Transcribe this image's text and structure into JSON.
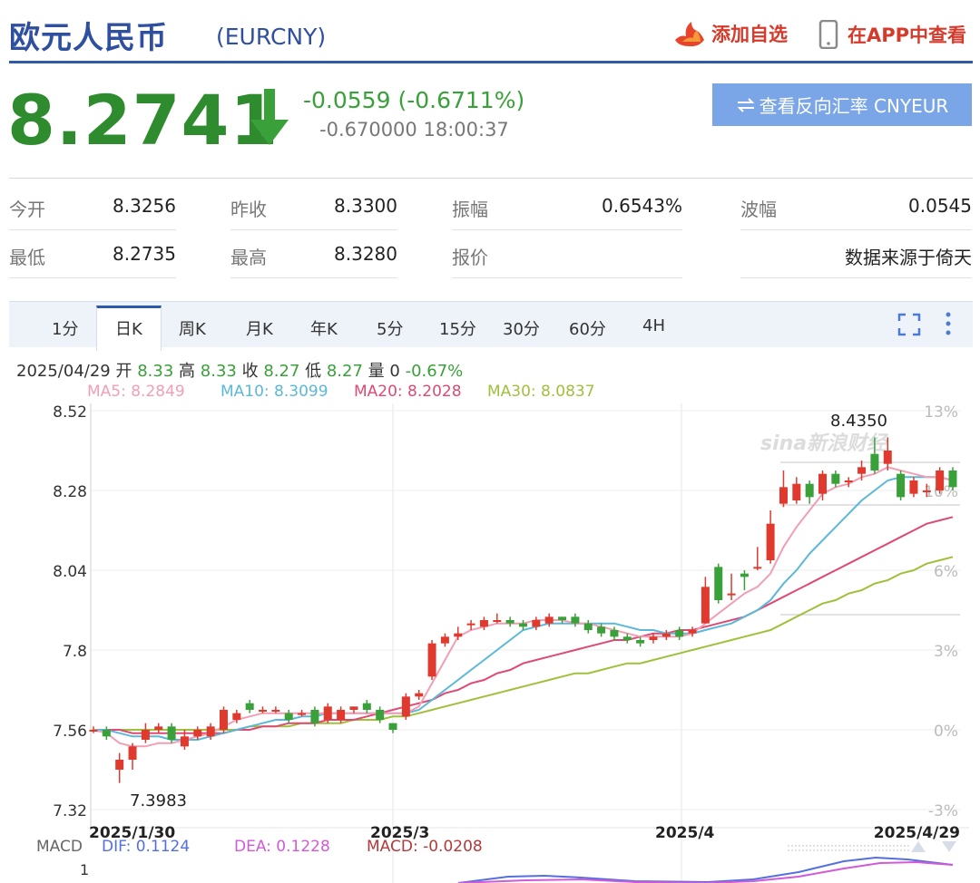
{
  "header": {
    "title": "欧元人民币",
    "code": "(EURCNY)",
    "add_watchlist": "添加自选",
    "view_app": "在APP中查看"
  },
  "quote": {
    "price": "8.2741",
    "change": "-0.0559 (-0.6711%)",
    "change2": "-0.670000",
    "time": "18:00:37",
    "reverse_btn": "查看反向汇率 CNYEUR"
  },
  "stats": {
    "open_label": "今开",
    "open": "8.3256",
    "prev_label": "昨收",
    "prev": "8.3300",
    "amp_label": "振幅",
    "amp": "0.6543%",
    "wave_label": "波幅",
    "wave": "0.0545",
    "low_label": "最低",
    "low": "8.2735",
    "high_label": "最高",
    "high": "8.3280",
    "quote_label": "报价",
    "source": "数据来源于倚天"
  },
  "tabs": [
    "1分",
    "日K",
    "周K",
    "月K",
    "年K",
    "5分",
    "15分",
    "30分",
    "60分",
    "4H"
  ],
  "active_tab": "日K",
  "ohlc": {
    "date": "2025/04/29",
    "open_label": "开",
    "open": "8.33",
    "high_label": "高",
    "high": "8.33",
    "close_label": "收",
    "close": "8.27",
    "low_label": "低",
    "low": "8.27",
    "vol_label": "量",
    "vol": "0",
    "pct": "-0.67%"
  },
  "ma": {
    "ma5": "MA5: 8.2849",
    "ma10": "MA10: 8.3099",
    "ma20": "MA20: 8.2028",
    "ma30": "MA30: 8.0837"
  },
  "macd": {
    "label": "MACD",
    "dif": "DIF: 0.1124",
    "dea": "DEA: 0.1228",
    "macd": "MACD: -0.0208",
    "axis_1": "1"
  },
  "colors": {
    "up": "#e03a2f",
    "down": "#3aa03a",
    "ma5": "#f29fb4",
    "ma10": "#5bb8d8",
    "ma20": "#de4a74",
    "ma30": "#a0c03c",
    "dif": "#5470e0",
    "dea": "#d25ad8",
    "macd": "#b33a3a"
  },
  "chart_data": {
    "type": "candlestick",
    "y_ticks": [
      "8.52",
      "8.28",
      "8.04",
      "7.8",
      "7.56",
      "7.32"
    ],
    "y_ticks_right": [
      "13%",
      "10%",
      "6%",
      "3%",
      "0%",
      "-3%"
    ],
    "x_ticks": [
      "2025/1/30",
      "2025/3",
      "2025/4",
      "2025/4/29"
    ],
    "ylim": [
      7.32,
      8.52
    ],
    "min_label": "7.3983",
    "max_label": "8.4350",
    "watermark": "sina新浪财经",
    "candles": [
      {
        "o": 7.56,
        "c": 7.56,
        "h": 7.57,
        "l": 7.55
      },
      {
        "o": 7.56,
        "c": 7.54,
        "h": 7.57,
        "l": 7.53
      },
      {
        "o": 7.44,
        "c": 7.47,
        "h": 7.49,
        "l": 7.4
      },
      {
        "o": 7.47,
        "c": 7.51,
        "h": 7.52,
        "l": 7.44
      },
      {
        "o": 7.53,
        "c": 7.56,
        "h": 7.58,
        "l": 7.52
      },
      {
        "o": 7.56,
        "c": 7.57,
        "h": 7.58,
        "l": 7.55
      },
      {
        "o": 7.57,
        "c": 7.53,
        "h": 7.58,
        "l": 7.52
      },
      {
        "o": 7.51,
        "c": 7.54,
        "h": 7.56,
        "l": 7.5
      },
      {
        "o": 7.54,
        "c": 7.56,
        "h": 7.57,
        "l": 7.53
      },
      {
        "o": 7.54,
        "c": 7.57,
        "h": 7.58,
        "l": 7.53
      },
      {
        "o": 7.56,
        "c": 7.62,
        "h": 7.63,
        "l": 7.55
      },
      {
        "o": 7.59,
        "c": 7.61,
        "h": 7.62,
        "l": 7.58
      },
      {
        "o": 7.64,
        "c": 7.62,
        "h": 7.65,
        "l": 7.61
      },
      {
        "o": 7.62,
        "c": 7.62,
        "h": 7.63,
        "l": 7.61
      },
      {
        "o": 7.62,
        "c": 7.62,
        "h": 7.63,
        "l": 7.61
      },
      {
        "o": 7.61,
        "c": 7.59,
        "h": 7.62,
        "l": 7.58
      },
      {
        "o": 7.61,
        "c": 7.61,
        "h": 7.62,
        "l": 7.6
      },
      {
        "o": 7.62,
        "c": 7.58,
        "h": 7.63,
        "l": 7.57
      },
      {
        "o": 7.59,
        "c": 7.63,
        "h": 7.64,
        "l": 7.58
      },
      {
        "o": 7.59,
        "c": 7.62,
        "h": 7.63,
        "l": 7.58
      },
      {
        "o": 7.62,
        "c": 7.63,
        "h": 7.63,
        "l": 7.61
      },
      {
        "o": 7.64,
        "c": 7.62,
        "h": 7.65,
        "l": 7.61
      },
      {
        "o": 7.62,
        "c": 7.59,
        "h": 7.63,
        "l": 7.58
      },
      {
        "o": 7.58,
        "c": 7.56,
        "h": 7.58,
        "l": 7.55
      },
      {
        "o": 7.6,
        "c": 7.66,
        "h": 7.67,
        "l": 7.59
      },
      {
        "o": 7.66,
        "c": 7.67,
        "h": 7.68,
        "l": 7.65
      },
      {
        "o": 7.72,
        "c": 7.82,
        "h": 7.83,
        "l": 7.71
      },
      {
        "o": 7.82,
        "c": 7.84,
        "h": 7.85,
        "l": 7.81
      },
      {
        "o": 7.84,
        "c": 7.85,
        "h": 7.87,
        "l": 7.83
      },
      {
        "o": 7.88,
        "c": 7.88,
        "h": 7.89,
        "l": 7.86
      },
      {
        "o": 7.87,
        "c": 7.89,
        "h": 7.9,
        "l": 7.86
      },
      {
        "o": 7.89,
        "c": 7.89,
        "h": 7.91,
        "l": 7.88
      },
      {
        "o": 7.89,
        "c": 7.88,
        "h": 7.9,
        "l": 7.87
      },
      {
        "o": 7.88,
        "c": 7.87,
        "h": 7.89,
        "l": 7.86
      },
      {
        "o": 7.87,
        "c": 7.89,
        "h": 7.9,
        "l": 7.86
      },
      {
        "o": 7.88,
        "c": 7.9,
        "h": 7.91,
        "l": 7.87
      },
      {
        "o": 7.9,
        "c": 7.89,
        "h": 7.9,
        "l": 7.88
      },
      {
        "o": 7.9,
        "c": 7.88,
        "h": 7.91,
        "l": 7.87
      },
      {
        "o": 7.88,
        "c": 7.86,
        "h": 7.89,
        "l": 7.85
      },
      {
        "o": 7.87,
        "c": 7.85,
        "h": 7.88,
        "l": 7.84
      },
      {
        "o": 7.86,
        "c": 7.84,
        "h": 7.87,
        "l": 7.83
      },
      {
        "o": 7.84,
        "c": 7.83,
        "h": 7.85,
        "l": 7.82
      },
      {
        "o": 7.83,
        "c": 7.82,
        "h": 7.84,
        "l": 7.81
      },
      {
        "o": 7.83,
        "c": 7.84,
        "h": 7.85,
        "l": 7.82
      },
      {
        "o": 7.84,
        "c": 7.85,
        "h": 7.86,
        "l": 7.83
      },
      {
        "o": 7.86,
        "c": 7.84,
        "h": 7.87,
        "l": 7.83
      },
      {
        "o": 7.85,
        "c": 7.86,
        "h": 7.87,
        "l": 7.84
      },
      {
        "o": 7.88,
        "c": 7.99,
        "h": 8.02,
        "l": 7.88
      },
      {
        "o": 8.05,
        "c": 7.95,
        "h": 8.06,
        "l": 7.94
      },
      {
        "o": 7.97,
        "c": 7.97,
        "h": 8.03,
        "l": 7.95
      },
      {
        "o": 8.03,
        "c": 8.02,
        "h": 8.04,
        "l": 7.98
      },
      {
        "o": 8.05,
        "c": 8.05,
        "h": 8.11,
        "l": 8.04
      },
      {
        "o": 8.07,
        "c": 8.18,
        "h": 8.22,
        "l": 8.06
      },
      {
        "o": 8.24,
        "c": 8.29,
        "h": 8.34,
        "l": 8.23
      },
      {
        "o": 8.25,
        "c": 8.3,
        "h": 8.32,
        "l": 8.24
      },
      {
        "o": 8.3,
        "c": 8.26,
        "h": 8.31,
        "l": 8.24
      },
      {
        "o": 8.27,
        "c": 8.33,
        "h": 8.34,
        "l": 8.25
      },
      {
        "o": 8.33,
        "c": 8.3,
        "h": 8.34,
        "l": 8.29
      },
      {
        "o": 8.31,
        "c": 8.31,
        "h": 8.32,
        "l": 8.29
      },
      {
        "o": 8.33,
        "c": 8.35,
        "h": 8.37,
        "l": 8.31
      },
      {
        "o": 8.39,
        "c": 8.34,
        "h": 8.44,
        "l": 8.33
      },
      {
        "o": 8.36,
        "c": 8.4,
        "h": 8.44,
        "l": 8.34
      },
      {
        "o": 8.33,
        "c": 8.26,
        "h": 8.34,
        "l": 8.25
      },
      {
        "o": 8.27,
        "c": 8.31,
        "h": 8.32,
        "l": 8.26
      },
      {
        "o": 8.28,
        "c": 8.28,
        "h": 8.3,
        "l": 8.26
      },
      {
        "o": 8.28,
        "c": 8.34,
        "h": 8.35,
        "l": 8.27
      },
      {
        "o": 8.34,
        "c": 8.29,
        "h": 8.35,
        "l": 8.28
      }
    ],
    "ma5": [
      7.56,
      7.55,
      7.52,
      7.51,
      7.51,
      7.52,
      7.52,
      7.53,
      7.54,
      7.55,
      7.57,
      7.59,
      7.6,
      7.61,
      7.61,
      7.61,
      7.61,
      7.61,
      7.61,
      7.61,
      7.61,
      7.61,
      7.61,
      7.61,
      7.61,
      7.63,
      7.7,
      7.77,
      7.84,
      7.86,
      7.87,
      7.88,
      7.88,
      7.88,
      7.89,
      7.89,
      7.89,
      7.88,
      7.88,
      7.87,
      7.86,
      7.85,
      7.84,
      7.84,
      7.84,
      7.84,
      7.85,
      7.88,
      7.91,
      7.94,
      7.97,
      7.99,
      8.03,
      8.11,
      8.17,
      8.22,
      8.27,
      8.29,
      8.3,
      8.32,
      8.33,
      8.35,
      8.34,
      8.33,
      8.32,
      8.32,
      8.31
    ],
    "ma10": [
      7.56,
      7.56,
      7.55,
      7.54,
      7.54,
      7.54,
      7.53,
      7.53,
      7.53,
      7.54,
      7.55,
      7.56,
      7.57,
      7.58,
      7.59,
      7.59,
      7.6,
      7.6,
      7.61,
      7.61,
      7.61,
      7.61,
      7.61,
      7.61,
      7.61,
      7.62,
      7.65,
      7.68,
      7.71,
      7.74,
      7.77,
      7.8,
      7.83,
      7.86,
      7.87,
      7.88,
      7.88,
      7.88,
      7.88,
      7.88,
      7.88,
      7.87,
      7.86,
      7.86,
      7.85,
      7.85,
      7.85,
      7.86,
      7.87,
      7.88,
      7.9,
      7.92,
      7.95,
      8.0,
      8.04,
      8.09,
      8.13,
      8.17,
      8.21,
      8.25,
      8.28,
      8.31,
      8.32,
      8.32,
      8.32,
      8.32,
      8.31
    ],
    "ma20": [
      7.56,
      7.56,
      7.56,
      7.55,
      7.55,
      7.55,
      7.55,
      7.55,
      7.55,
      7.55,
      7.55,
      7.56,
      7.56,
      7.57,
      7.57,
      7.58,
      7.58,
      7.58,
      7.59,
      7.59,
      7.59,
      7.6,
      7.61,
      7.62,
      7.63,
      7.64,
      7.65,
      7.67,
      7.68,
      7.7,
      7.71,
      7.73,
      7.74,
      7.76,
      7.77,
      7.78,
      7.79,
      7.8,
      7.81,
      7.82,
      7.83,
      7.83,
      7.84,
      7.85,
      7.85,
      7.86,
      7.86,
      7.87,
      7.88,
      7.89,
      7.9,
      7.92,
      7.94,
      7.96,
      7.98,
      8.0,
      8.02,
      8.04,
      8.06,
      8.08,
      8.1,
      8.12,
      8.14,
      8.16,
      8.18,
      8.19,
      8.2
    ],
    "ma30": [
      7.56,
      7.56,
      7.56,
      7.56,
      7.56,
      7.56,
      7.56,
      7.56,
      7.56,
      7.56,
      7.56,
      7.56,
      7.57,
      7.57,
      7.57,
      7.57,
      7.58,
      7.58,
      7.58,
      7.58,
      7.59,
      7.59,
      7.59,
      7.6,
      7.6,
      7.61,
      7.62,
      7.63,
      7.64,
      7.65,
      7.66,
      7.67,
      7.68,
      7.69,
      7.7,
      7.71,
      7.72,
      7.73,
      7.73,
      7.74,
      7.75,
      7.76,
      7.76,
      7.77,
      7.78,
      7.79,
      7.8,
      7.81,
      7.82,
      7.83,
      7.84,
      7.85,
      7.86,
      7.88,
      7.9,
      7.92,
      7.94,
      7.95,
      7.97,
      7.98,
      8.0,
      8.01,
      8.03,
      8.04,
      8.06,
      8.07,
      8.08
    ]
  }
}
